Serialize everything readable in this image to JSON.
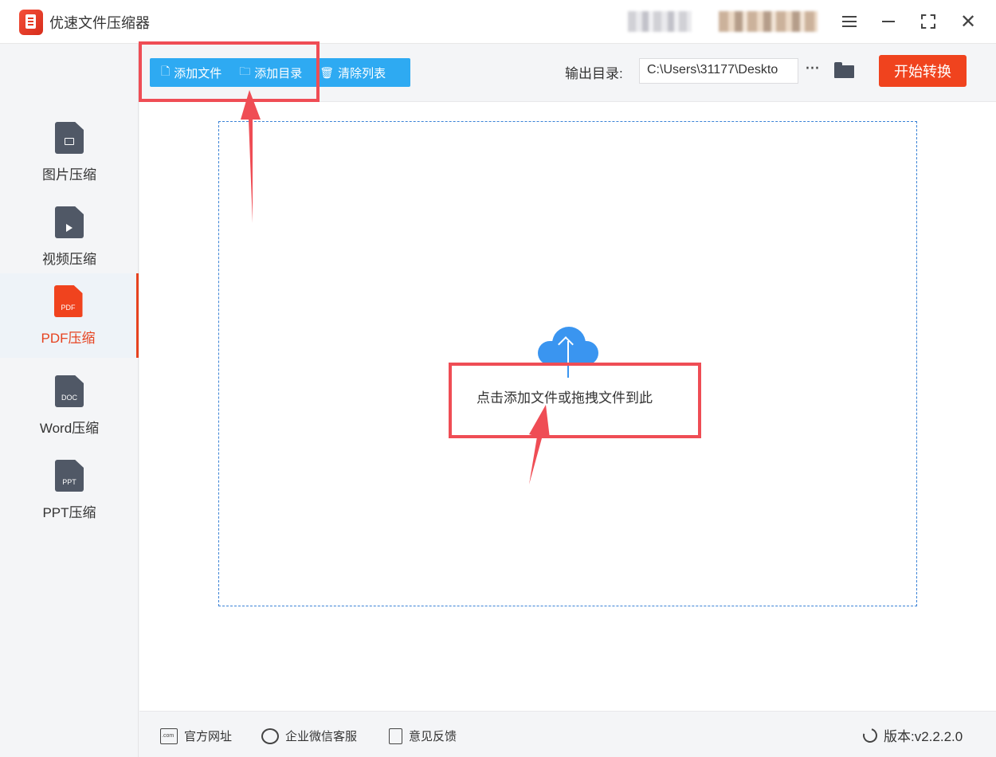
{
  "app": {
    "title": "优速文件压缩器"
  },
  "sidebar": {
    "items": [
      {
        "label": "图片压缩",
        "icon": "image-file-icon"
      },
      {
        "label": "视频压缩",
        "icon": "video-file-icon"
      },
      {
        "label": "PDF压缩",
        "icon": "pdf-file-icon",
        "file_text": "PDF",
        "active": true
      },
      {
        "label": "Word压缩",
        "icon": "doc-file-icon",
        "file_text": "DOC"
      },
      {
        "label": "PPT压缩",
        "icon": "ppt-file-icon",
        "file_text": "PPT"
      }
    ]
  },
  "toolbar": {
    "add_file": "添加文件",
    "add_folder": "添加目录",
    "clear_list": "清除列表",
    "output_label": "输出目录:",
    "output_path": "C:\\Users\\31177\\Deskto",
    "more": "···",
    "start": "开始转换"
  },
  "dropzone": {
    "hint": "点击添加文件或拖拽文件到此"
  },
  "footer": {
    "website": "官方网址",
    "wechat": "企业微信客服",
    "feedback": "意见反馈",
    "version": "版本:v2.2.2.0"
  },
  "colors": {
    "accent": "#f0431e",
    "primary": "#2eaaf2",
    "annotation": "#ef4d55",
    "cloud": "#3a95f0"
  }
}
